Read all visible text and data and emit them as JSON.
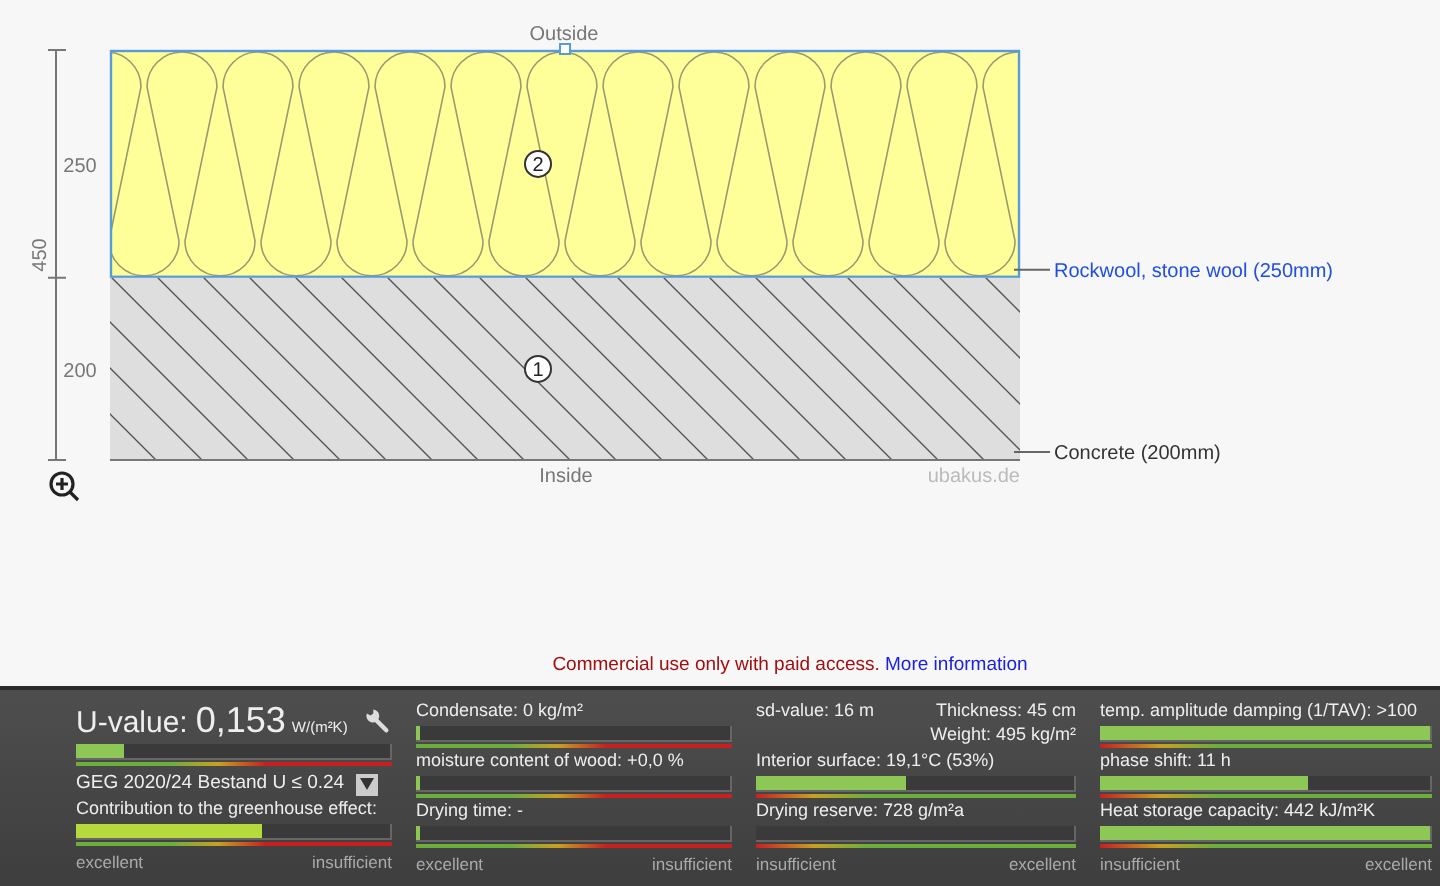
{
  "diagram": {
    "outside_label": "Outside",
    "inside_label": "Inside",
    "credit": "ubakus.de",
    "total_thickness": "450",
    "layers": [
      {
        "number": "2",
        "kind": "insulation",
        "thickness": "250",
        "label": "Rockwool, stone wool (250mm)",
        "selected": true
      },
      {
        "number": "1",
        "kind": "concrete",
        "thickness": "200",
        "label": "Concrete (200mm)",
        "selected": false
      }
    ]
  },
  "notice": {
    "text": "Commercial use only with paid access.",
    "link": "More information"
  },
  "results": [
    {
      "kind": "good_left",
      "scale_left": "excellent",
      "scale_right": "insufficient",
      "items": [
        {
          "kind": "uvalue",
          "label": "U-value:",
          "value": "0,153",
          "unit": "W/(m²K)",
          "level": 0.15,
          "color": "#8dc856",
          "standard": "GEG 2020/24 Bestand U ≤ 0.24"
        },
        {
          "kind": "meter",
          "label": "Contribution to the greenhouse effect:",
          "level": 0.59,
          "color": "#b6d93c"
        }
      ]
    },
    {
      "kind": "good_left",
      "scale_left": "excellent",
      "scale_right": "insufficient",
      "items": [
        {
          "kind": "meter",
          "label": "Condensate: 0 kg/m²",
          "level": 0.01,
          "color": "#8dc856"
        },
        {
          "kind": "meter",
          "label": "moisture content of wood: +0,0 %",
          "level": 0.01,
          "color": "#8dc856"
        },
        {
          "kind": "meter",
          "label": "Drying time: -",
          "level": 0.01,
          "color": "#8dc856"
        }
      ]
    },
    {
      "kind": "good_right",
      "scale_left": "insufficient",
      "scale_right": "excellent",
      "items": [
        {
          "kind": "info",
          "label": "sd-value: 16 m",
          "details": [
            "Thickness: 45 cm",
            "Weight: 495 kg/m²"
          ]
        },
        {
          "kind": "meter",
          "label": "Interior surface: 19,1°C (53%)",
          "level": 0.47,
          "color": "#8dc856"
        },
        {
          "kind": "meter",
          "label": "Drying reserve: 728 g/m²a"
        }
      ]
    },
    {
      "kind": "good_right",
      "scale_left": "insufficient",
      "scale_right": "excellent",
      "items": [
        {
          "kind": "meter",
          "label": "temp. amplitude damping (1/TAV): >100",
          "level": 1,
          "color": "#8dc856"
        },
        {
          "kind": "meter",
          "label": "phase shift: 11 h",
          "level": 0.63,
          "color": "#8dc856"
        },
        {
          "kind": "meter",
          "label": "Heat storage capacity: 442 kJ/m²K",
          "level": 1,
          "color": "#8dc856"
        }
      ]
    }
  ]
}
